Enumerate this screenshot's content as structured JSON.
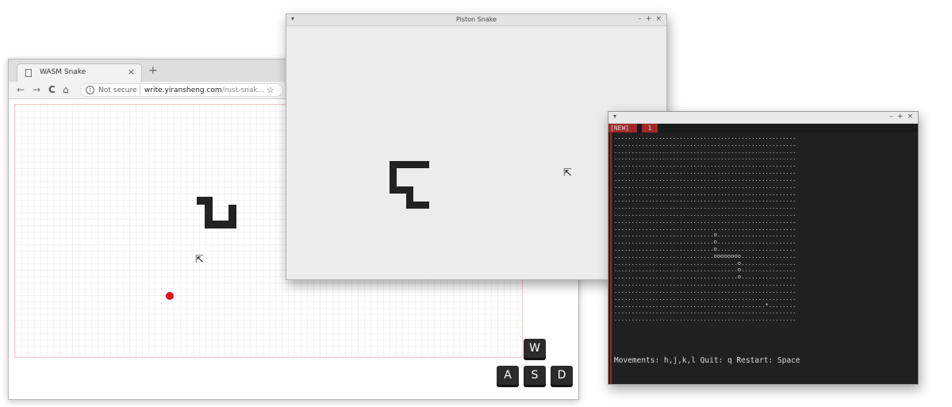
{
  "browser": {
    "tab_title": "WASM Snake",
    "tab_close": "×",
    "new_tab": "+",
    "nav_back": "←",
    "nav_forward": "→",
    "nav_reload": "C",
    "nav_home": "⌂",
    "info_glyph": "i",
    "security_label": "Not secure",
    "url_domain": "write.yiransheng.com",
    "url_path": "/rust-snak...",
    "star_glyph": "☆",
    "keys": {
      "up": "W",
      "left": "A",
      "down": "S",
      "right": "D"
    },
    "food_color": "#e01010"
  },
  "piston": {
    "menu_glyph": "▾",
    "title": "Piston Snake",
    "ctrl_min": "–",
    "ctrl_max": "+",
    "ctrl_close": "×"
  },
  "terminal": {
    "menu_glyph": "▾",
    "ctrl_min": "–",
    "ctrl_max": "+",
    "ctrl_close": "×",
    "tab_new": "[NEW]",
    "tab_num": "1",
    "grid_rows": [
      ".....................................................",
      ".....................................................",
      ".....................................................",
      ".....................................................",
      ".....................................................",
      ".....................................................",
      ".....................................................",
      ".....................................................",
      ".....................................................",
      ".....................................................",
      ".....................................................",
      ".....................................................",
      ".....................................................",
      ".....................................................",
      ".............................o.......................",
      ".............................o.......................",
      ".............................o.......................",
      ".............................oooooooo................",
      "....................................o................",
      "....................................o................",
      "....................................o................",
      ".....................................................",
      ".....................................................",
      ".....................................................",
      "............................................*........",
      ".....................................................",
      "....................................................."
    ],
    "status": "Movements: h,j,k,l Quit: q Restart: Space"
  }
}
